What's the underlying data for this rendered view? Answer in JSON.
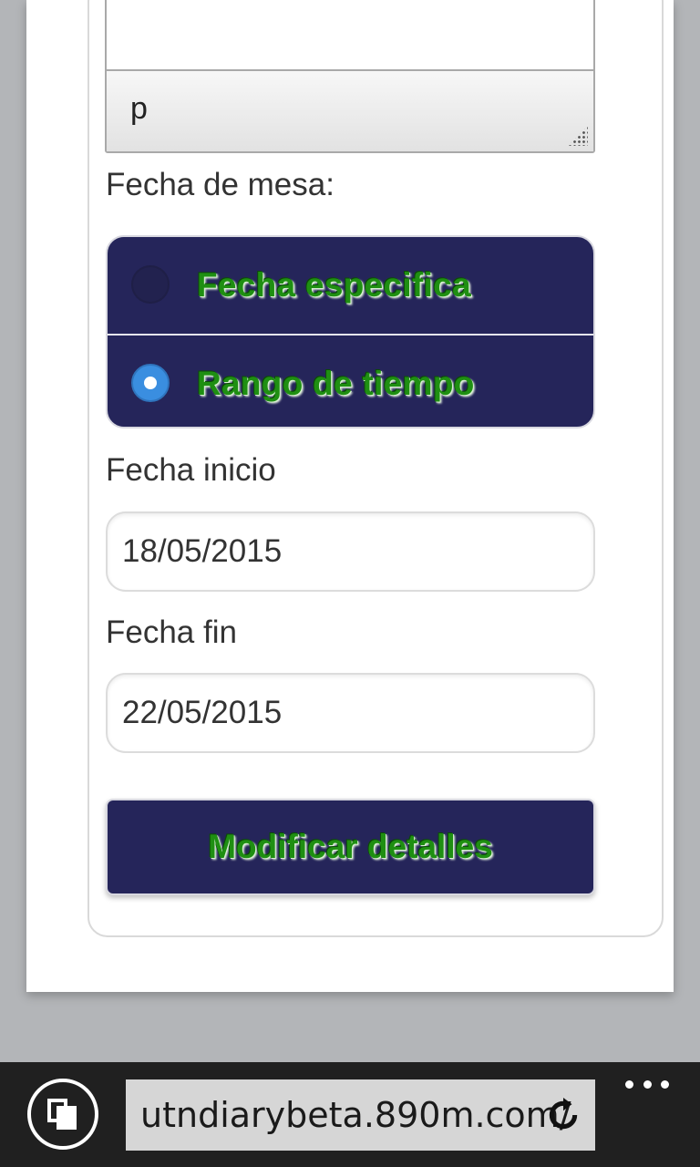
{
  "form": {
    "textarea_value": "p",
    "date_mode_label": "Fecha de mesa:",
    "date_mode_options": [
      {
        "label": "Fecha especifica",
        "selected": false
      },
      {
        "label": "Rango de tiempo",
        "selected": true
      }
    ],
    "start_date_label": "Fecha inicio",
    "start_date_value": "18/05/2015",
    "end_date_label": "Fecha fin",
    "end_date_value": "22/05/2015",
    "submit_label": "Modificar detalles"
  },
  "browser": {
    "address": "utndiarybeta.890m.com/",
    "icons": {
      "tabs": "tabs-icon",
      "refresh": "refresh-icon",
      "more": "more-dots-icon"
    }
  },
  "colors": {
    "panel_background": "#25255a",
    "label_green": "#1f8f12",
    "radio_selected": "#3a8ee0",
    "browser_bar": "#202020",
    "address_field": "#d6d6d6"
  }
}
